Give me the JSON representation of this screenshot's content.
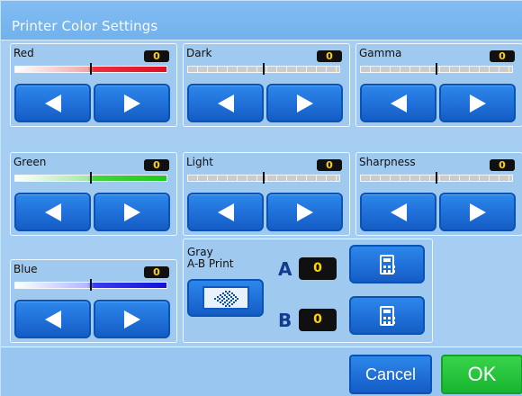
{
  "window": {
    "title": "Printer Color Settings"
  },
  "panels": {
    "red": {
      "label": "Red",
      "value": "0"
    },
    "dark": {
      "label": "Dark",
      "value": "0"
    },
    "gamma": {
      "label": "Gamma",
      "value": "0"
    },
    "green": {
      "label": "Green",
      "value": "0"
    },
    "light": {
      "label": "Light",
      "value": "0"
    },
    "sharpness": {
      "label": "Sharpness",
      "value": "0"
    },
    "blue": {
      "label": "Blue",
      "value": "0"
    }
  },
  "gray_ab": {
    "label_line1": "Gray",
    "label_line2": "A-B Print",
    "a_label": "A",
    "a_value": "0",
    "b_label": "B",
    "b_value": "0"
  },
  "footer": {
    "cancel_label": "Cancel",
    "ok_label": "OK"
  },
  "icons": {
    "left_arrow": "left-arrow-icon",
    "right_arrow": "right-arrow-icon",
    "calculator": "calculator-icon",
    "pattern": "dot-pattern-icon"
  },
  "colors": {
    "background": "#a7d0f4",
    "button_blue": "#1f6fd8",
    "ok_green": "#17b631",
    "value_text": "#ffd400"
  },
  "sliders": {
    "red": 0.5,
    "dark": 0.5,
    "gamma": 0.5,
    "green": 0.5,
    "light": 0.5,
    "sharpness": 0.5,
    "blue": 0.5
  }
}
